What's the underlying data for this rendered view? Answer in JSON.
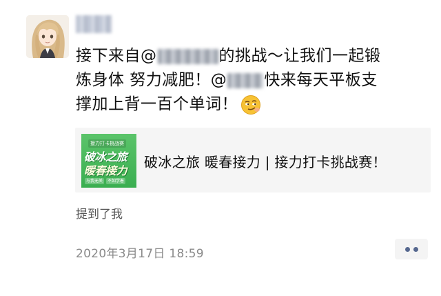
{
  "post": {
    "text_line1_a": "接下来自@",
    "text_line1_b": "的挑战～让我们一起锻",
    "text_line2_a": "炼身体 努力减肥！@",
    "text_line2_b": "快来每天平板支",
    "text_line3": "撑加上背一百个单词！",
    "emoji": "smirk-emoji"
  },
  "link_card": {
    "thumb_top": "接力打卡挑战赛",
    "thumb_line1": "破冰之旅",
    "thumb_line2": "暖春接力",
    "thumb_bottom": [
      "与我无关",
      "不如学着"
    ],
    "title": "破冰之旅 暖春接力 | 接力打卡挑战赛！"
  },
  "mentioned_label": "提到了我",
  "timestamp": "2020年3月17日 18:59",
  "colors": {
    "accent_dots": "#56688f",
    "thumb_green": "#3aae50",
    "card_bg": "#f5f5f5"
  }
}
